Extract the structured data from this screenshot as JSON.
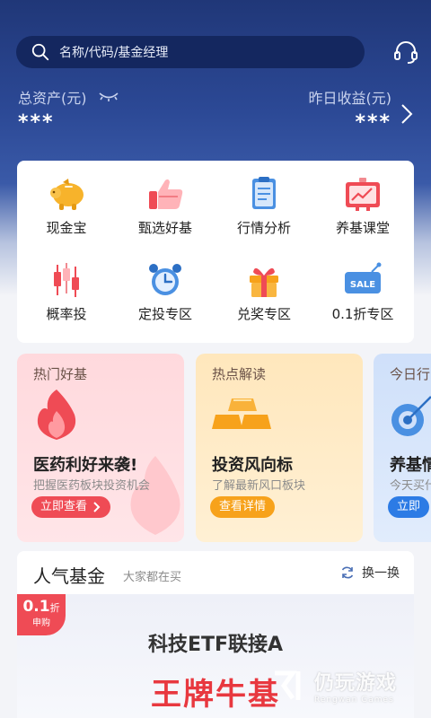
{
  "colors": {
    "primary": "#203778",
    "accent_red": "#ef4b55",
    "accent_orange": "#f7a21b",
    "accent_blue": "#2c7be5",
    "card_pink": "#ffdde1",
    "card_yellow": "#ffecc7",
    "card_blue": "#d9e6fb"
  },
  "search": {
    "placeholder": "名称/代码/基金经理",
    "icon": "search-icon"
  },
  "header": {
    "service_icon": "headset-icon"
  },
  "assets": {
    "total_label": "总资产(元)",
    "total_value": "***",
    "yesterday_label": "昨日收益(元)",
    "yesterday_value": "***",
    "visibility_icon": "eye-closed-icon"
  },
  "menu": {
    "items": [
      {
        "label": "现金宝",
        "icon": "piggy-bank-icon"
      },
      {
        "label": "甄选好基",
        "icon": "thumbs-up-icon"
      },
      {
        "label": "行情分析",
        "icon": "clipboard-icon"
      },
      {
        "label": "养基课堂",
        "icon": "chart-board-icon"
      },
      {
        "label": "概率投",
        "icon": "candlestick-icon"
      },
      {
        "label": "定投专区",
        "icon": "alarm-clock-icon"
      },
      {
        "label": "兑奖专区",
        "icon": "gift-icon"
      },
      {
        "label": "0.1折专区",
        "icon": "sale-tag-icon"
      }
    ]
  },
  "promos": [
    {
      "tag": "热门好基",
      "title": "医药利好来袭!",
      "subtitle": "把握医药板块投资机会",
      "button": "立即查看",
      "icon": "flame-icon"
    },
    {
      "tag": "热点解读",
      "title": "投资风向标",
      "subtitle": "了解最新风口板块",
      "button": "查看详情",
      "icon": "gold-bars-icon"
    },
    {
      "tag": "今日行",
      "title": "养基情",
      "subtitle": "今天买什",
      "button": "立即",
      "icon": "target-icon"
    }
  ],
  "popular": {
    "title": "人气基金",
    "subtitle": "大家都在买",
    "refresh_label": "换一换",
    "discount": {
      "value": "0.1",
      "unit": "折",
      "label": "申购"
    },
    "fund_name": "科技ETF联接A",
    "slogan": "王牌牛基"
  },
  "watermark": {
    "cn": "仍玩游戏",
    "en": "Rengwan Games"
  }
}
